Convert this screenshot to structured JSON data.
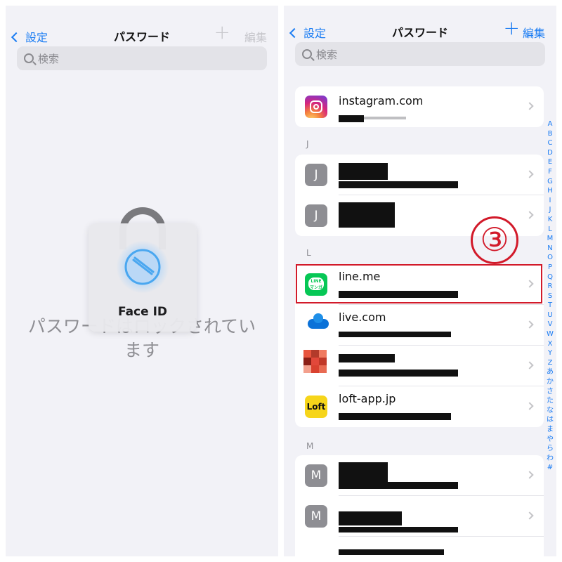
{
  "left": {
    "back_label": "設定",
    "title": "パスワード",
    "plus": "+",
    "edit_label": "編集",
    "search_placeholder": "検索",
    "locked_message": "パスワードはロックされています",
    "faceid_label": "Face ID",
    "colors": {
      "back": "#1a7cf3",
      "disabled": "#c7c7cc"
    }
  },
  "right": {
    "back_label": "設定",
    "title": "パスワード",
    "plus": "+",
    "edit_label": "編集",
    "search_placeholder": "検索",
    "sections": {
      "j": "J",
      "l": "L",
      "m": "M"
    },
    "rows": {
      "instagram": {
        "site": "instagram.com",
        "icon": "instagram-icon"
      },
      "j1": {
        "letter": "J"
      },
      "j2": {
        "letter": "J"
      },
      "line": {
        "site": "line.me",
        "icon": "line-icon",
        "icon_text": "LINE マンガ"
      },
      "live": {
        "site": "live.com",
        "icon": "onedrive-cloud-icon"
      },
      "redacted": {
        "icon": "pixelated-icon"
      },
      "loft": {
        "site": "loft-app.jp",
        "icon": "loft-icon",
        "icon_text": "Loft"
      },
      "m1": {
        "letter": "M"
      },
      "m2": {
        "letter": "M"
      }
    },
    "index": [
      "A",
      "B",
      "C",
      "D",
      "E",
      "F",
      "G",
      "H",
      "I",
      "J",
      "K",
      "L",
      "M",
      "N",
      "O",
      "P",
      "Q",
      "R",
      "S",
      "T",
      "U",
      "V",
      "W",
      "X",
      "Y",
      "Z",
      "あ",
      "か",
      "さ",
      "た",
      "な",
      "は",
      "ま",
      "や",
      "ら",
      "わ",
      "#"
    ],
    "step_marker": "③",
    "colors": {
      "accent": "#1a7cf3",
      "highlight": "#d21a2a"
    }
  }
}
